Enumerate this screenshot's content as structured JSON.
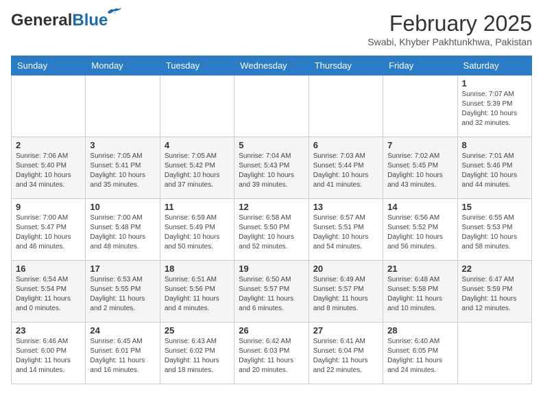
{
  "logo": {
    "general": "General",
    "blue": "Blue"
  },
  "title": {
    "month_year": "February 2025",
    "location": "Swabi, Khyber Pakhtunkhwa, Pakistan"
  },
  "weekdays": [
    "Sunday",
    "Monday",
    "Tuesday",
    "Wednesday",
    "Thursday",
    "Friday",
    "Saturday"
  ],
  "weeks": [
    [
      {
        "day": "",
        "info": ""
      },
      {
        "day": "",
        "info": ""
      },
      {
        "day": "",
        "info": ""
      },
      {
        "day": "",
        "info": ""
      },
      {
        "day": "",
        "info": ""
      },
      {
        "day": "",
        "info": ""
      },
      {
        "day": "1",
        "info": "Sunrise: 7:07 AM\nSunset: 5:39 PM\nDaylight: 10 hours\nand 32 minutes."
      }
    ],
    [
      {
        "day": "2",
        "info": "Sunrise: 7:06 AM\nSunset: 5:40 PM\nDaylight: 10 hours\nand 34 minutes."
      },
      {
        "day": "3",
        "info": "Sunrise: 7:05 AM\nSunset: 5:41 PM\nDaylight: 10 hours\nand 35 minutes."
      },
      {
        "day": "4",
        "info": "Sunrise: 7:05 AM\nSunset: 5:42 PM\nDaylight: 10 hours\nand 37 minutes."
      },
      {
        "day": "5",
        "info": "Sunrise: 7:04 AM\nSunset: 5:43 PM\nDaylight: 10 hours\nand 39 minutes."
      },
      {
        "day": "6",
        "info": "Sunrise: 7:03 AM\nSunset: 5:44 PM\nDaylight: 10 hours\nand 41 minutes."
      },
      {
        "day": "7",
        "info": "Sunrise: 7:02 AM\nSunset: 5:45 PM\nDaylight: 10 hours\nand 43 minutes."
      },
      {
        "day": "8",
        "info": "Sunrise: 7:01 AM\nSunset: 5:46 PM\nDaylight: 10 hours\nand 44 minutes."
      }
    ],
    [
      {
        "day": "9",
        "info": "Sunrise: 7:00 AM\nSunset: 5:47 PM\nDaylight: 10 hours\nand 46 minutes."
      },
      {
        "day": "10",
        "info": "Sunrise: 7:00 AM\nSunset: 5:48 PM\nDaylight: 10 hours\nand 48 minutes."
      },
      {
        "day": "11",
        "info": "Sunrise: 6:59 AM\nSunset: 5:49 PM\nDaylight: 10 hours\nand 50 minutes."
      },
      {
        "day": "12",
        "info": "Sunrise: 6:58 AM\nSunset: 5:50 PM\nDaylight: 10 hours\nand 52 minutes."
      },
      {
        "day": "13",
        "info": "Sunrise: 6:57 AM\nSunset: 5:51 PM\nDaylight: 10 hours\nand 54 minutes."
      },
      {
        "day": "14",
        "info": "Sunrise: 6:56 AM\nSunset: 5:52 PM\nDaylight: 10 hours\nand 56 minutes."
      },
      {
        "day": "15",
        "info": "Sunrise: 6:55 AM\nSunset: 5:53 PM\nDaylight: 10 hours\nand 58 minutes."
      }
    ],
    [
      {
        "day": "16",
        "info": "Sunrise: 6:54 AM\nSunset: 5:54 PM\nDaylight: 11 hours\nand 0 minutes."
      },
      {
        "day": "17",
        "info": "Sunrise: 6:53 AM\nSunset: 5:55 PM\nDaylight: 11 hours\nand 2 minutes."
      },
      {
        "day": "18",
        "info": "Sunrise: 6:51 AM\nSunset: 5:56 PM\nDaylight: 11 hours\nand 4 minutes."
      },
      {
        "day": "19",
        "info": "Sunrise: 6:50 AM\nSunset: 5:57 PM\nDaylight: 11 hours\nand 6 minutes."
      },
      {
        "day": "20",
        "info": "Sunrise: 6:49 AM\nSunset: 5:57 PM\nDaylight: 11 hours\nand 8 minutes."
      },
      {
        "day": "21",
        "info": "Sunrise: 6:48 AM\nSunset: 5:58 PM\nDaylight: 11 hours\nand 10 minutes."
      },
      {
        "day": "22",
        "info": "Sunrise: 6:47 AM\nSunset: 5:59 PM\nDaylight: 11 hours\nand 12 minutes."
      }
    ],
    [
      {
        "day": "23",
        "info": "Sunrise: 6:46 AM\nSunset: 6:00 PM\nDaylight: 11 hours\nand 14 minutes."
      },
      {
        "day": "24",
        "info": "Sunrise: 6:45 AM\nSunset: 6:01 PM\nDaylight: 11 hours\nand 16 minutes."
      },
      {
        "day": "25",
        "info": "Sunrise: 6:43 AM\nSunset: 6:02 PM\nDaylight: 11 hours\nand 18 minutes."
      },
      {
        "day": "26",
        "info": "Sunrise: 6:42 AM\nSunset: 6:03 PM\nDaylight: 11 hours\nand 20 minutes."
      },
      {
        "day": "27",
        "info": "Sunrise: 6:41 AM\nSunset: 6:04 PM\nDaylight: 11 hours\nand 22 minutes."
      },
      {
        "day": "28",
        "info": "Sunrise: 6:40 AM\nSunset: 6:05 PM\nDaylight: 11 hours\nand 24 minutes."
      },
      {
        "day": "",
        "info": ""
      }
    ]
  ]
}
